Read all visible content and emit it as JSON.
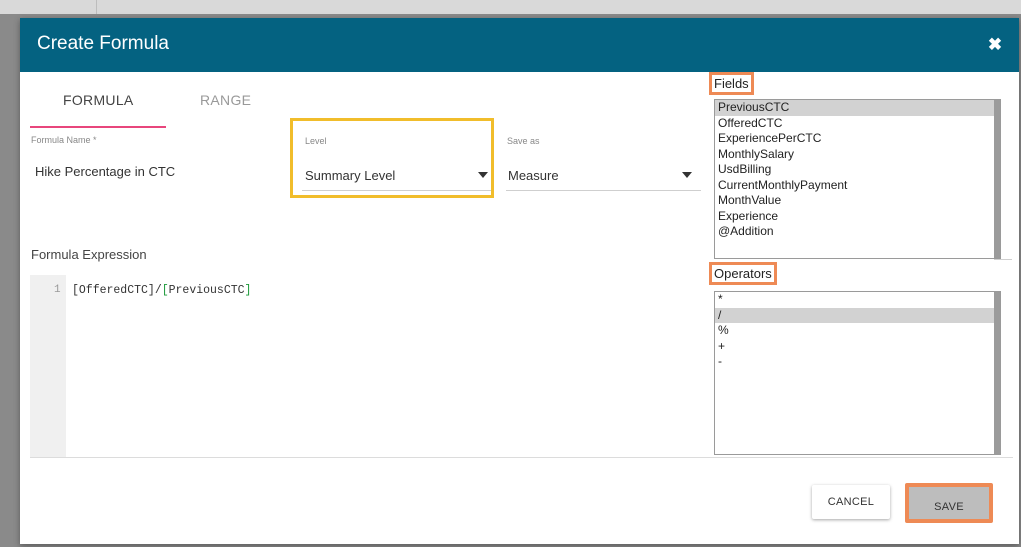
{
  "dialog": {
    "title": "Create Formula",
    "close_icon": "close-icon"
  },
  "tabs": [
    {
      "label": "FORMULA",
      "active": true
    },
    {
      "label": "RANGE",
      "active": false
    }
  ],
  "formula_name": {
    "label": "Formula Name *",
    "value": "Hike Percentage in CTC"
  },
  "level": {
    "label": "Level",
    "value": "Summary Level"
  },
  "save_as": {
    "label": "Save as",
    "value": "Measure"
  },
  "expression": {
    "label": "Formula Expression",
    "line_number": "1",
    "part1": "[OfferedCTC]/",
    "part2": "[",
    "part3": "PreviousCTC",
    "part4": "]"
  },
  "fields": {
    "title": "Fields",
    "items": [
      "PreviousCTC",
      "OfferedCTC",
      "ExperiencePerCTC",
      "MonthlySalary",
      "UsdBilling",
      "CurrentMonthlyPayment",
      "MonthValue",
      "Experience",
      "@Addition"
    ],
    "selected": "PreviousCTC"
  },
  "operators": {
    "title": "Operators",
    "items": [
      "*",
      "/",
      "%",
      "+",
      "-"
    ],
    "selected": "/"
  },
  "buttons": {
    "cancel": "CANCEL",
    "save": "SAVE"
  },
  "colors": {
    "header": "#046281",
    "tab_underline": "#e8467c",
    "highlight_yellow": "#f1bd2b",
    "highlight_orange": "#ee8a55"
  }
}
